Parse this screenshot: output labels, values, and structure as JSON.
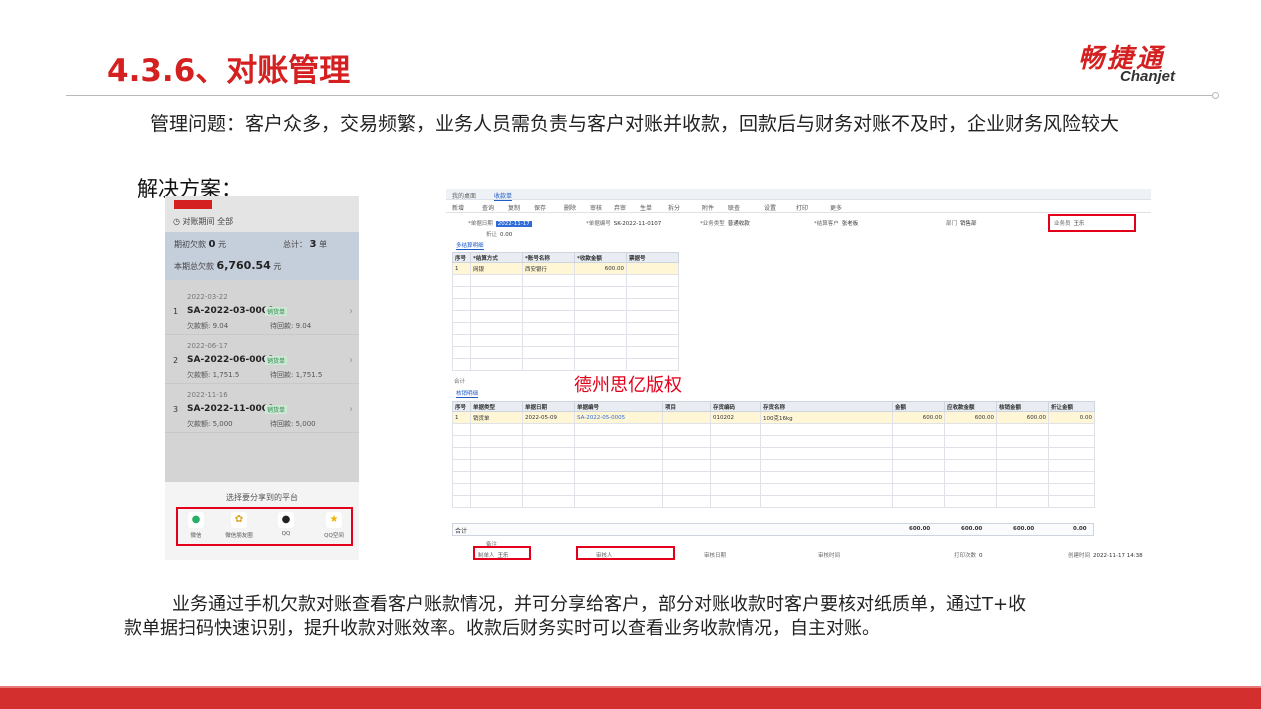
{
  "slide": {
    "title": "4.3.6、对账管理",
    "problem": "管理问题：客户众多，交易频繁，业务人员需负责与客户对账并收款，回款后与财务对账不及时，企业财务风险较大",
    "solution_label": "解决方案：",
    "body": "业务通过手机欠款对账查看客户账款情况，并可分享给客户，部分对账收款时客户要核对纸质单，通过T+收款单据扫码快速识别，提升收款对账效率。收款后财务实时可以查看业务收款情况，自主对账。"
  },
  "logo": {
    "cn": "畅捷通",
    "en": "Chanjet"
  },
  "phone": {
    "period": "对账期间 全部",
    "summary_owe_label": "期初欠款",
    "summary_owe_value": "0",
    "summary_owe_unit": "元",
    "summary_total_label": "总计：",
    "summary_total_value": "3",
    "summary_total_unit": "单",
    "summary_period_label": "本期总欠款",
    "summary_period_value": "6,760.54",
    "summary_period_unit": "元",
    "items": [
      {
        "date": "2022-03-22",
        "index": "1",
        "code": "SA-2022-03-0001",
        "tag": "销货单",
        "owe": "欠款额: 9.04",
        "balance": "待回款: 9.04"
      },
      {
        "date": "2022-06-17",
        "index": "2",
        "code": "SA-2022-06-0001",
        "tag": "销货单",
        "owe": "欠款额: 1,751.5",
        "balance": "待回款: 1,751.5"
      },
      {
        "date": "2022-11-16",
        "index": "3",
        "code": "SA-2022-11-0001",
        "tag": "销货单",
        "owe": "欠款额: 5,000",
        "balance": "待回款: 5,000"
      }
    ],
    "share_title": "选择要分享到的平台",
    "share_apps": [
      {
        "label": "微信",
        "icon": "wechat-icon"
      },
      {
        "label": "微信朋友圈",
        "icon": "moments-icon"
      },
      {
        "label": "QQ",
        "icon": "qq-icon"
      },
      {
        "label": "QQ空间",
        "icon": "qzone-icon"
      }
    ]
  },
  "desktop": {
    "tabs": [
      "我的桌面",
      "收款单"
    ],
    "toolbar": [
      "新增",
      "查询",
      "复制",
      "保存",
      "删除",
      "审核",
      "弃审",
      "生单",
      "拆分",
      "附件",
      "联查",
      "设置",
      "打印",
      "更多"
    ],
    "fields": {
      "date_label": "*单据日期",
      "date_value": "2022-11-17",
      "code_label": "*单据编号",
      "code_value": "SK-2022-11-0107",
      "type_label": "*业务类型",
      "type_value": "普通收款",
      "customer_label": "*结算客户",
      "customer_value": "张老板",
      "dept_label": "部门",
      "dept_value": "销售部",
      "salesman_label": "业务员",
      "salesman_value": "王乐",
      "discount_label": "折让",
      "discount_value": "0.00"
    },
    "settle_tab": "多结算明细",
    "settle_headers": [
      "序号",
      "*结算方式",
      "*账号名称",
      "*收款金额",
      "票据号"
    ],
    "settle_rows": [
      [
        "1",
        "网银",
        "西安银行",
        "600.00",
        ""
      ]
    ],
    "settle_empty_rows": 8,
    "total_label": "合计",
    "detail_tab": "核销明细",
    "detail_headers": [
      "序号",
      "单据类型",
      "单据日期",
      "单据编号",
      "项目",
      "存货编码",
      "存货名称",
      "金额",
      "应收款金额",
      "核销金额",
      "折让金额"
    ],
    "detail_rows": [
      [
        "1",
        "销货单",
        "2022-05-09",
        "SA-2022-05-0005",
        "",
        "010202",
        "100克16kg",
        "600.00",
        "600.00",
        "600.00",
        "0.00"
      ]
    ],
    "detail_empty_rows": 7,
    "detail_total": [
      "600.00",
      "600.00",
      "600.00",
      "0.00"
    ],
    "footer": {
      "remark_label": "备注",
      "maker_label": "制单人",
      "maker_value": "王乐",
      "auditor_label": "审核人",
      "auditor_value": "",
      "audit_date_label": "审核日期",
      "audit_time_label": "审核时间",
      "print_label": "打印次数",
      "print_value": "0",
      "create_label": "创建时间",
      "create_value": "2022-11-17 14:38"
    },
    "watermark": "德州思亿版权"
  },
  "colors": {
    "brand_red": "#d42020",
    "highlight_red": "#e3001b",
    "footer_bar": "#d32f2f"
  }
}
